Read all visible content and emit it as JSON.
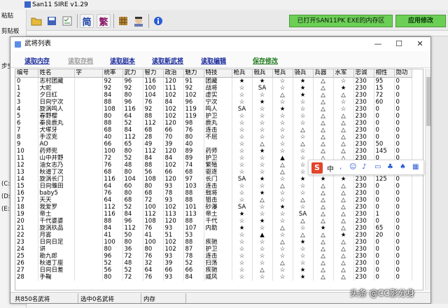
{
  "app": {
    "title": "San11 SIRE v1.29",
    "open_status": "已打开SAN11PK EXE的内存区",
    "apply_label": "应用修改"
  },
  "left_panel": {
    "items": [
      "粘贴",
      "剪贴板",
      "步空",
      "(C:)",
      "(D:)",
      "(E:)"
    ]
  },
  "toolbar": {
    "labels": [
      "简",
      "繁"
    ]
  },
  "window": {
    "title": "武将列表",
    "min": "—",
    "max": "☐",
    "close": "✕"
  },
  "menu": {
    "items": [
      "读取内存",
      "读取存档",
      "读取剧本",
      "读取新武将",
      "读取编辑",
      "保存修改"
    ]
  },
  "columns": [
    "编号",
    "姓名",
    "字",
    "统率",
    "武力",
    "智力",
    "政治",
    "魅力",
    "特技",
    "枪兵",
    "戟兵",
    "弩兵",
    "骑兵",
    "兵器",
    "水军",
    "忠诚",
    "相性",
    "勋功"
  ],
  "rows": [
    [
      "0",
      "志村团藏",
      "",
      "92",
      "96",
      "116",
      "120",
      "91",
      "团藏",
      "★",
      "★",
      "☆",
      "★",
      "△",
      "☆",
      "230",
      "95",
      "0"
    ],
    [
      "1",
      "大蛇",
      "",
      "92",
      "92",
      "100",
      "111",
      "92",
      "战将",
      "☆",
      "SA",
      "☆",
      "★",
      "△",
      "★",
      "230",
      "15",
      "0"
    ],
    [
      "2",
      "夕日红",
      "",
      "84",
      "80",
      "104",
      "102",
      "102",
      "虚实",
      "☆",
      "☆",
      "△",
      "★",
      "△",
      "△",
      "230",
      "72",
      "0"
    ],
    [
      "3",
      "日向宁次",
      "",
      "88",
      "96",
      "76",
      "84",
      "96",
      "宁次",
      "☆",
      "★",
      "☆",
      "☆",
      "△",
      "☆",
      "230",
      "60",
      "0"
    ],
    [
      "4",
      "旋涡鸣人",
      "",
      "108",
      "116",
      "92",
      "102",
      "119",
      "鸣人",
      "SA",
      "☆",
      "★",
      "☆",
      "△",
      "☆",
      "230",
      "0",
      "0"
    ],
    [
      "5",
      "春野樱",
      "",
      "80",
      "64",
      "88",
      "102",
      "119",
      "护卫",
      "☆",
      "☆",
      "☆",
      "☆",
      "△",
      "△",
      "230",
      "0",
      "0"
    ],
    [
      "6",
      "秦良鹿丸",
      "",
      "88",
      "52",
      "112",
      "120",
      "98",
      "鹿丸",
      "☆",
      "☆",
      "☆",
      "☆",
      "△",
      "△",
      "230",
      "0",
      "0"
    ],
    [
      "7",
      "犬塚牙",
      "",
      "68",
      "84",
      "68",
      "66",
      "76",
      "连击",
      "☆",
      "☆",
      "☆",
      "△",
      "△",
      "△",
      "230",
      "0",
      "0"
    ],
    [
      "8",
      "手涩克",
      "",
      "40",
      "112",
      "28",
      "70",
      "80",
      "不屈",
      "☆",
      "☆",
      "☆",
      "☆",
      "△",
      "△",
      "230",
      "0",
      "0"
    ],
    [
      "9",
      "AO",
      "",
      "66",
      "65",
      "49",
      "39",
      "40",
      "",
      "☆",
      "△",
      "☆",
      "△",
      "△",
      "△",
      "230",
      "50",
      "0"
    ],
    [
      "10",
      "药师兜",
      "",
      "100",
      "80",
      "112",
      "120",
      "89",
      "药师",
      "☆",
      "★",
      "☆",
      "☆",
      "△",
      "△",
      "230",
      "145",
      "0"
    ],
    [
      "11",
      "山中井野",
      "",
      "72",
      "52",
      "84",
      "84",
      "89",
      "护卫",
      "☆",
      "☆",
      "▲",
      "☆",
      "△",
      "△",
      "230",
      "0",
      "0"
    ],
    [
      "12",
      "油女志乃",
      "",
      "76",
      "48",
      "88",
      "102",
      "74",
      "繁殖",
      "☆",
      "☆",
      "△",
      "☆",
      "△",
      "△",
      "230",
      "0",
      "0"
    ],
    [
      "13",
      "秋道丁次",
      "",
      "68",
      "80",
      "56",
      "66",
      "68",
      "驱逐",
      "☆",
      "☆",
      "△",
      "☆",
      "△",
      "△",
      "230",
      "0",
      "0"
    ],
    [
      "14",
      "旋涡长门",
      "",
      "116",
      "104",
      "108",
      "120",
      "97",
      "长门",
      "SA",
      "★",
      "☆",
      "★",
      "★",
      "★",
      "230",
      "125",
      "0"
    ],
    [
      "15",
      "日向雏田",
      "",
      "64",
      "60",
      "80",
      "93",
      "103",
      "连击",
      "☆",
      "☆",
      "△",
      "☆",
      "△",
      "△",
      "230",
      "0",
      "0"
    ],
    [
      "16",
      "baby5",
      "",
      "76",
      "80",
      "68",
      "78",
      "88",
      "戟将",
      "☆",
      "★",
      "☆",
      "☆",
      "△",
      "△",
      "230",
      "0",
      "0"
    ],
    [
      "17",
      "天天",
      "",
      "64",
      "68",
      "72",
      "93",
      "88",
      "狙击",
      "☆",
      "△",
      "☆",
      "△",
      "△",
      "△",
      "230",
      "0",
      "0"
    ],
    [
      "18",
      "我爱罗",
      "",
      "112",
      "52",
      "100",
      "102",
      "101",
      "砂瀑",
      "SA",
      "☆",
      "★",
      "☆",
      "△",
      "△",
      "230",
      "0",
      "0"
    ],
    [
      "19",
      "帝土",
      "",
      "116",
      "84",
      "112",
      "113",
      "113",
      "帝土",
      "★",
      "☆",
      "☆",
      "SA",
      "△",
      "△",
      "230",
      "1",
      "0"
    ],
    [
      "20",
      "千代婆婆",
      "",
      "88",
      "96",
      "108",
      "120",
      "88",
      "千代",
      "☆",
      "★",
      "☆",
      "△",
      "△",
      "△",
      "230",
      "0",
      "0"
    ],
    [
      "21",
      "旋涡玖品",
      "",
      "84",
      "112",
      "76",
      "93",
      "107",
      "内助",
      "★",
      "☆",
      "△",
      "☆",
      "★",
      "△",
      "230",
      "65",
      "0"
    ],
    [
      "22",
      "月雾",
      "",
      "41",
      "50",
      "41",
      "51",
      "53",
      "",
      "☆",
      "▲",
      "☆",
      "△",
      "△",
      "★",
      "230",
      "20",
      "0"
    ],
    [
      "23",
      "日向日足",
      "",
      "100",
      "80",
      "100",
      "102",
      "88",
      "疾驰",
      "☆",
      "☆",
      "△",
      "★",
      "△",
      "△",
      "230",
      "0",
      "0"
    ],
    [
      "24",
      "讲",
      "",
      "80",
      "36",
      "80",
      "102",
      "87",
      "护卫",
      "☆",
      "☆",
      "☆",
      "☆",
      "△",
      "△",
      "230",
      "0",
      "0"
    ],
    [
      "25",
      "勘九郎",
      "",
      "96",
      "72",
      "76",
      "93",
      "78",
      "连击",
      "☆",
      "☆",
      "☆",
      "☆",
      "△",
      "△",
      "230",
      "0",
      "0"
    ],
    [
      "26",
      "秋道丁座",
      "",
      "52",
      "48",
      "32",
      "39",
      "52",
      "扫荡",
      "☆",
      "☆",
      "△",
      "☆",
      "△",
      "△",
      "230",
      "0",
      "0"
    ],
    [
      "27",
      "日向日差",
      "",
      "56",
      "52",
      "64",
      "66",
      "66",
      "疾驰",
      "☆",
      "△",
      "☆",
      "★",
      "△",
      "△",
      "230",
      "0",
      "0"
    ],
    [
      "28",
      "手鞠",
      "",
      "80",
      "72",
      "76",
      "93",
      "84",
      "威风",
      "☆",
      "☆",
      "☆",
      "★",
      "△",
      "△",
      "230",
      "0",
      "0"
    ]
  ],
  "status": {
    "count": "共850名武将",
    "selected": "选中0名武将",
    "mode": "内存"
  },
  "ime": {
    "label": "中"
  },
  "watermark": "头条 @CC影分身"
}
